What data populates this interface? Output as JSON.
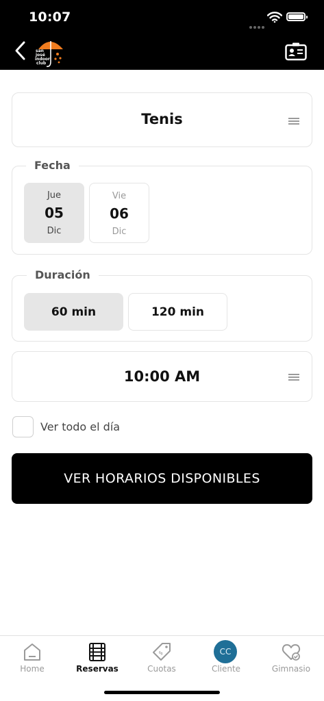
{
  "status": {
    "time": "10:07"
  },
  "nav": {
    "logo_lines": [
      "san",
      "josé",
      "indoor",
      "club"
    ]
  },
  "sport": {
    "value": "Tenis"
  },
  "fecha": {
    "label": "Fecha",
    "days": [
      {
        "weekday": "Jue",
        "day": "05",
        "month": "Dic",
        "selected": true
      },
      {
        "weekday": "Vie",
        "day": "06",
        "month": "Dic",
        "selected": false
      }
    ]
  },
  "duracion": {
    "label": "Duración",
    "options": [
      {
        "label": "60 min",
        "selected": true
      },
      {
        "label": "120 min",
        "selected": false
      }
    ]
  },
  "time_select": {
    "value": "10:00 AM"
  },
  "all_day": {
    "label": "Ver todo el día",
    "checked": false
  },
  "cta": {
    "label": "VER HORARIOS DISPONIBLES"
  },
  "tabs": [
    {
      "label": "Home",
      "icon": "home-icon",
      "active": false
    },
    {
      "label": "Reservas",
      "icon": "film-calendar-icon",
      "active": true
    },
    {
      "label": "Cuotas",
      "icon": "price-tag-icon",
      "active": false
    },
    {
      "label": "Cliente",
      "icon": "avatar",
      "avatar_text": "CC",
      "active": false
    },
    {
      "label": "Gimnasio",
      "icon": "heart-check-icon",
      "active": false
    }
  ],
  "colors": {
    "accent_orange": "#f07c1f",
    "avatar_blue": "#1f6f97",
    "primary_black": "#000000"
  }
}
